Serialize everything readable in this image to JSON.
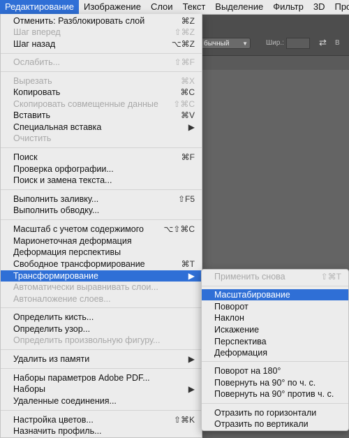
{
  "menubar": {
    "items": [
      "Редактирование",
      "Изображение",
      "Слои",
      "Текст",
      "Выделение",
      "Фильтр",
      "3D",
      "Про"
    ]
  },
  "options_bar": {
    "blend_mode": "бычный",
    "width_label": "Шир.:",
    "height_label": "В"
  },
  "edit_menu": {
    "items": [
      {
        "label": "Отменить: Разблокировать слой",
        "shortcut": "⌘Z"
      },
      {
        "label": "Шаг вперед",
        "shortcut": "⇧⌘Z"
      },
      {
        "label": "Шаг назад",
        "shortcut": "⌥⌘Z"
      },
      {
        "label": "Ослабить...",
        "shortcut": "⇧⌘F"
      },
      {
        "label": "Вырезать",
        "shortcut": "⌘X"
      },
      {
        "label": "Копировать",
        "shortcut": "⌘C"
      },
      {
        "label": "Скопировать совмещенные данные",
        "shortcut": "⇧⌘C"
      },
      {
        "label": "Вставить",
        "shortcut": "⌘V"
      },
      {
        "label": "Специальная вставка",
        "shortcut": "▶"
      },
      {
        "label": "Очистить",
        "shortcut": ""
      },
      {
        "label": "Поиск",
        "shortcut": "⌘F"
      },
      {
        "label": "Проверка орфографии...",
        "shortcut": ""
      },
      {
        "label": "Поиск и замена текста...",
        "shortcut": ""
      },
      {
        "label": "Выполнить заливку...",
        "shortcut": "⇧F5"
      },
      {
        "label": "Выполнить обводку...",
        "shortcut": ""
      },
      {
        "label": "Масштаб с учетом содержимого",
        "shortcut": "⌥⇧⌘C"
      },
      {
        "label": "Марионеточная деформация",
        "shortcut": ""
      },
      {
        "label": "Деформация перспективы",
        "shortcut": ""
      },
      {
        "label": "Свободное трансформирование",
        "shortcut": "⌘T"
      },
      {
        "label": "Трансформирование",
        "shortcut": "▶"
      },
      {
        "label": "Автоматически выравнивать слои...",
        "shortcut": ""
      },
      {
        "label": "Автоналожение слоев...",
        "shortcut": ""
      },
      {
        "label": "Определить кисть...",
        "shortcut": ""
      },
      {
        "label": "Определить узор...",
        "shortcut": ""
      },
      {
        "label": "Определить произвольную фигуру...",
        "shortcut": ""
      },
      {
        "label": "Удалить из памяти",
        "shortcut": "▶"
      },
      {
        "label": "Наборы параметров Adobe PDF...",
        "shortcut": ""
      },
      {
        "label": "Наборы",
        "shortcut": "▶"
      },
      {
        "label": "Удаленные соединения...",
        "shortcut": ""
      },
      {
        "label": "Настройка цветов...",
        "shortcut": "⇧⌘K"
      },
      {
        "label": "Назначить профиль...",
        "shortcut": ""
      }
    ]
  },
  "transform_submenu": {
    "items": [
      {
        "label": "Применить снова",
        "shortcut": "⇧⌘T"
      },
      {
        "label": "Масштабирование",
        "shortcut": ""
      },
      {
        "label": "Поворот",
        "shortcut": ""
      },
      {
        "label": "Наклон",
        "shortcut": ""
      },
      {
        "label": "Искажение",
        "shortcut": ""
      },
      {
        "label": "Перспектива",
        "shortcut": ""
      },
      {
        "label": "Деформация",
        "shortcut": ""
      },
      {
        "label": "Поворот на 180°",
        "shortcut": ""
      },
      {
        "label": "Повернуть на 90° по ч. с.",
        "shortcut": ""
      },
      {
        "label": "Повернуть на 90° против ч. с.",
        "shortcut": ""
      },
      {
        "label": "Отразить по горизонтали",
        "shortcut": ""
      },
      {
        "label": "Отразить по вертикали",
        "shortcut": ""
      }
    ]
  }
}
